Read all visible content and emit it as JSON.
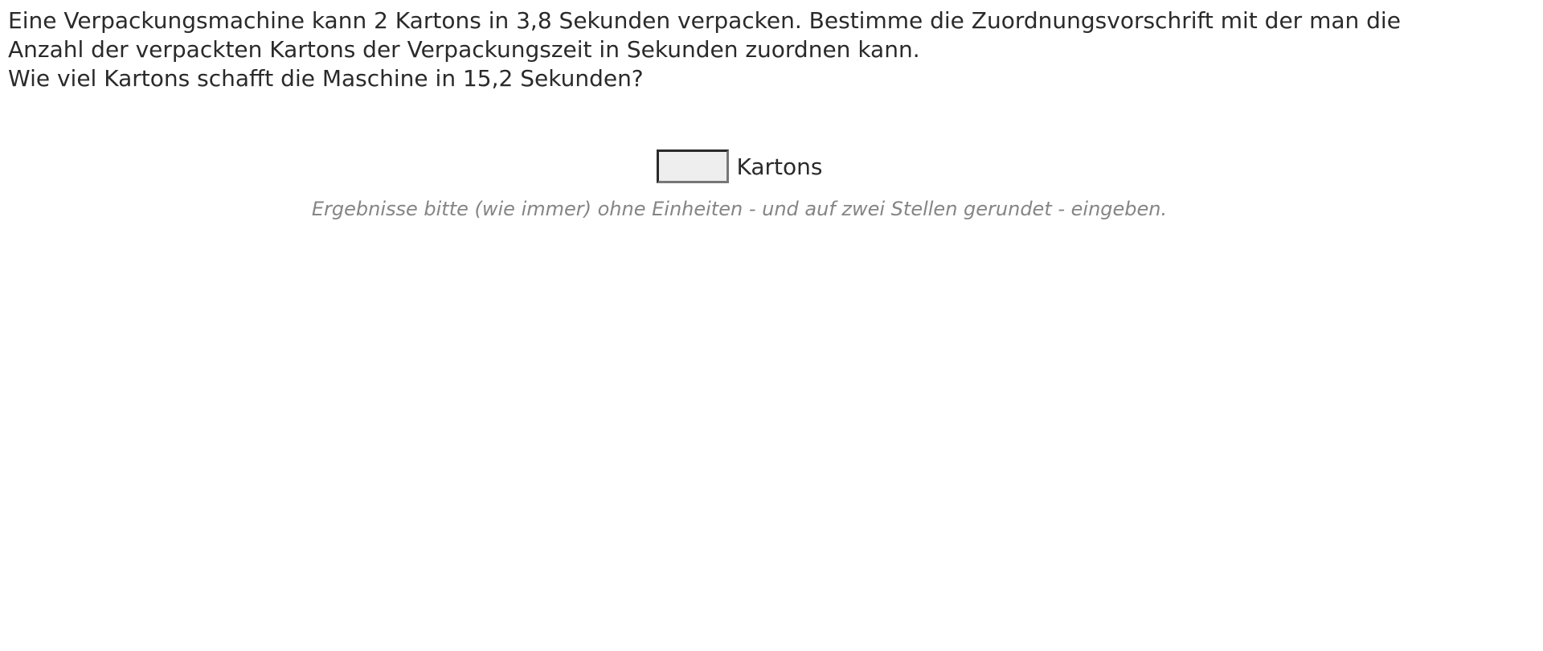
{
  "question": {
    "line1": "Eine Verpackungsmachine kann 2 Kartons in 3,8 Sekunden verpacken. Bestimme die Zuordnungsvorschrift mit der man die",
    "line2": "Anzahl der verpackten Kartons der Verpackungszeit in Sekunden zuordnen kann.",
    "line3": "Wie viel Kartons schafft die Maschine in 15,2 Sekunden?"
  },
  "answer": {
    "value": "",
    "unit": "Kartons"
  },
  "hint": "Ergebnisse bitte (wie immer) ohne Einheiten - und auf zwei Stellen gerundet - eingeben."
}
